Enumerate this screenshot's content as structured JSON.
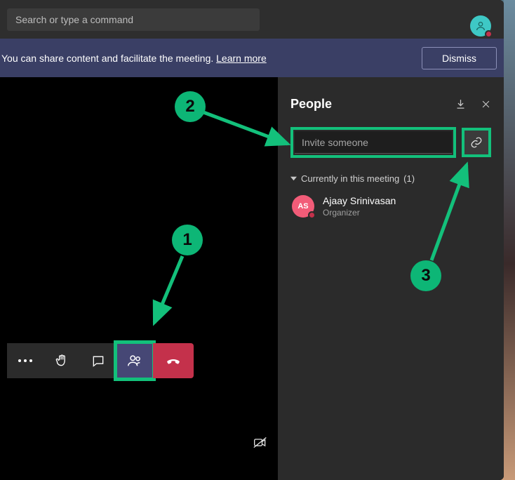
{
  "titlebar": {
    "search_placeholder": "Search or type a command"
  },
  "banner": {
    "text_prefix": "You can share content and facilitate the meeting. ",
    "link_text": "Learn more",
    "dismiss": "Dismiss"
  },
  "people_panel": {
    "title": "People",
    "invite_placeholder": "Invite someone",
    "section_label": "Currently in this meeting",
    "section_count": "(1)",
    "participants": [
      {
        "initials": "AS",
        "name": "Ajaay Srinivasan",
        "role": "Organizer"
      }
    ]
  },
  "callouts": {
    "c1": "1",
    "c2": "2",
    "c3": "3"
  }
}
